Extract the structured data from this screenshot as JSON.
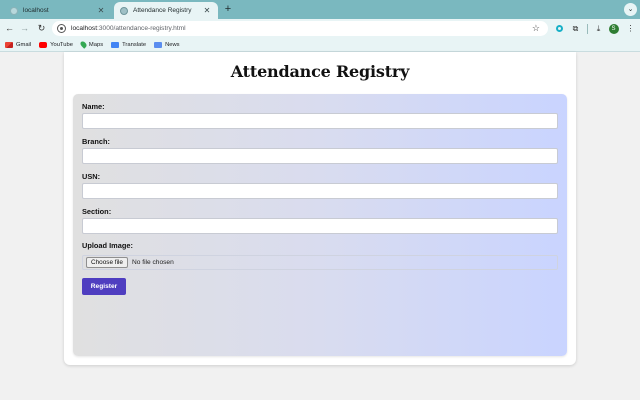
{
  "browser": {
    "tabs": [
      {
        "title": "localhost",
        "active": false
      },
      {
        "title": "Attendance Registry",
        "active": true
      }
    ],
    "url_host": "localhost",
    "url_path": ":3000/attendance-registry.html",
    "profile_initial": "S",
    "bookmarks": [
      {
        "label": "Gmail",
        "icon": "gmail-icon"
      },
      {
        "label": "YouTube",
        "icon": "youtube-icon"
      },
      {
        "label": "Maps",
        "icon": "maps-icon"
      },
      {
        "label": "Translate",
        "icon": "translate-icon"
      },
      {
        "label": "News",
        "icon": "news-icon"
      }
    ]
  },
  "page": {
    "title": "Attendance Registry",
    "fields": [
      {
        "label": "Name:",
        "value": ""
      },
      {
        "label": "Branch:",
        "value": ""
      },
      {
        "label": "USN:",
        "value": ""
      },
      {
        "label": "Section:",
        "value": ""
      }
    ],
    "upload_label": "Upload Image:",
    "choose_file_label": "Choose file",
    "no_file_text": "No file chosen",
    "register_label": "Register"
  },
  "colors": {
    "chrome_tabstrip": "#7ab8bf",
    "register_button": "#4f3ec0",
    "panel_gradient_start": "#e0e0e0",
    "panel_gradient_end": "#c9d4ff"
  }
}
